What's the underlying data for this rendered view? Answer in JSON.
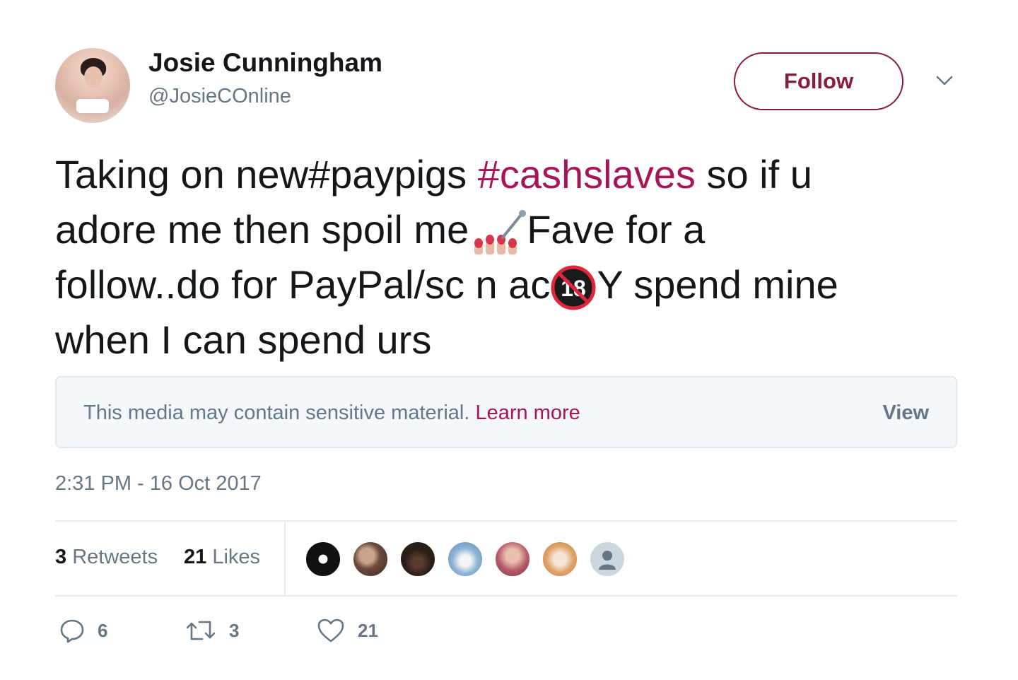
{
  "tweet": {
    "author_name": "Josie Cunningham",
    "author_handle": "@JosieCOnline",
    "follow_label": "Follow",
    "text": {
      "l1_a": "Taking on new",
      "l1_tag1": "#paypigs",
      "l1_tag2": "#cashslaves",
      "l1_b": " so if u",
      "l2_a": "adore me then spoil me",
      "l2_b": "Fave for a",
      "l3_a": "follow..do for PayPal/sc n ac",
      "l3_b": "Y spend mine",
      "l4": "when I can spend urs"
    },
    "emojis": [
      "nail-polish-emoji",
      "no-one-under-eighteen-emoji"
    ],
    "sensitive": {
      "message": "This media may contain sensitive material.",
      "learn_more": "Learn more",
      "view": "View"
    },
    "timestamp": "2:31 PM - 16 Oct 2017",
    "stats": {
      "retweets_count": "3",
      "retweets_label": "Retweets",
      "likes_count": "21",
      "likes_label": "Likes"
    },
    "likers": [
      {
        "icon": "liker-avatar-1",
        "color": "#111111"
      },
      {
        "icon": "liker-avatar-2",
        "color": "#6b4a3a"
      },
      {
        "icon": "liker-avatar-3",
        "color": "#2a1e18"
      },
      {
        "icon": "liker-avatar-4",
        "color": "#8fb4d8"
      },
      {
        "icon": "liker-avatar-5",
        "color": "#d7a08a"
      },
      {
        "icon": "liker-avatar-6",
        "color": "#e0a46a"
      },
      {
        "icon": "default-avatar",
        "color": "#ccd6dd"
      }
    ],
    "actions": {
      "reply_count": "6",
      "retweet_count": "3",
      "like_count": "21"
    },
    "colors": {
      "accent": "#a6155a",
      "button_border": "#8a1a3e",
      "secondary_text": "#657786",
      "primary_text": "#14171a"
    }
  }
}
